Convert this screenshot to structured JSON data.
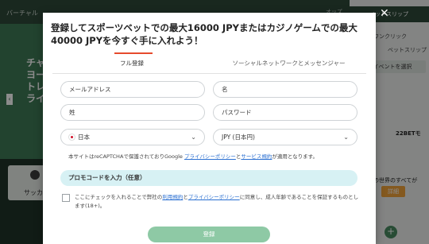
{
  "background": {
    "nav_text": "バーチャル",
    "odds_label": "オッズ",
    "hero_lines": [
      "チャ",
      "ヨー",
      "トレ",
      "ライ"
    ],
    "arrow_icon": "chevron-left-icon",
    "card_label": "サッカ",
    "bet_slip": {
      "title": "ベットスリップ",
      "one_click": "ワンクリック",
      "slip_label": "ベットスリップ",
      "event_button": "イベントを選択",
      "promo_22bet": "22BETモ",
      "world_text": "の世界のすべてが",
      "detail_button": "詳細"
    }
  },
  "modal": {
    "title": "登録してスポーツベットでの最大16000 JPYまたはカジノゲームでの最大40000 JPYを今すぐ手に入れよう！",
    "tabs": [
      {
        "label": "フル登録",
        "active": true
      },
      {
        "label": "ソーシャルネットワークとメッセンジャー",
        "active": false
      }
    ],
    "fields": {
      "email_placeholder": "メールアドレス",
      "first_name_placeholder": "名",
      "last_name_placeholder": "姓",
      "password_placeholder": "パスワード",
      "country_value": "日本",
      "currency_value": "JPY (日本円)"
    },
    "recaptcha": {
      "prefix": "本サイトはreCAPTCHAで保護されておりGoogle ",
      "privacy_link": "プライバシーポリシー",
      "and": "と",
      "terms_link": "サービス規約",
      "suffix": "が適用となります。"
    },
    "promo_label": "プロモコードを入力（任意）",
    "consent": {
      "part1": "ここにチェックを入れることで弊社の",
      "terms_link": "利用規約",
      "and": "と",
      "privacy_link": "プライバシーポリシー",
      "part2": "に同意し、成人年齢であることを保証するものとします(18+)。"
    },
    "submit_label": "登録"
  },
  "colors": {
    "tab_indicator": "#e64b2d",
    "promo_bg": "#d7f1f4",
    "submit_bg": "#8ec9a5",
    "link": "#2a6fd1"
  }
}
